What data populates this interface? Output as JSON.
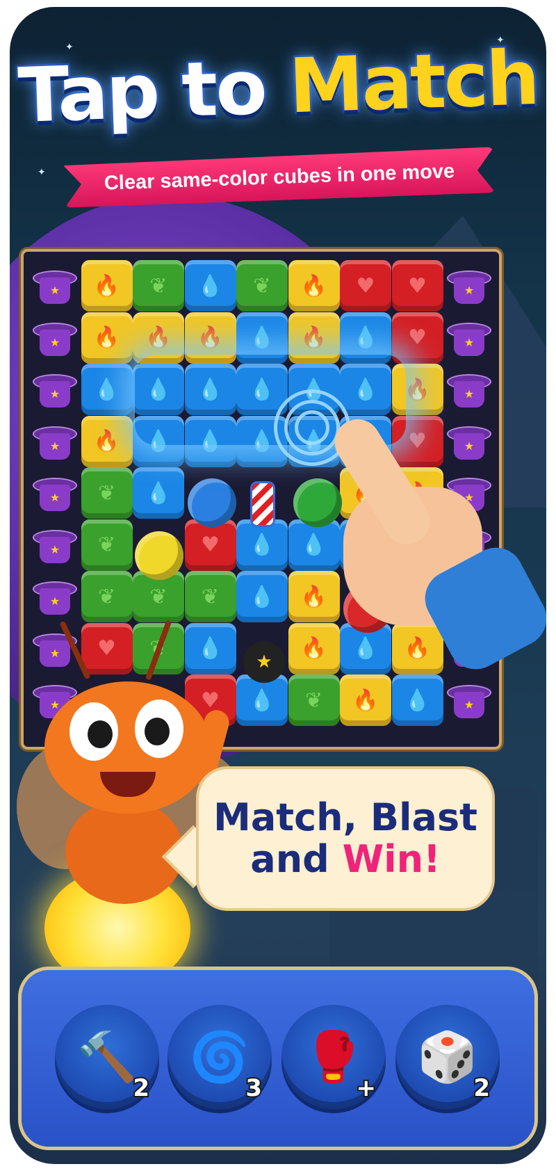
{
  "title": {
    "word1": "Tap to",
    "word2": "Match"
  },
  "subtitle": "Clear same-color cubes in one move",
  "speech": {
    "line1": "Match, Blast",
    "line2_prefix": "and ",
    "line2_highlight": "Win!"
  },
  "board": {
    "columns": 9,
    "grid": [
      [
        "hat",
        "yellow",
        "green",
        "blue",
        "green",
        "yellow",
        "red",
        "red",
        "hat"
      ],
      [
        "hat",
        "yellow",
        "yellow",
        "yellow",
        "blue",
        "yellow",
        "blue",
        "red",
        "hat"
      ],
      [
        "hat",
        "blue",
        "blue",
        "blue",
        "blue",
        "blue",
        "blue",
        "yellow",
        "hat"
      ],
      [
        "hat",
        "yellow",
        "blue",
        "blue",
        "blue",
        "blue",
        "blue",
        "red",
        "hat"
      ],
      [
        "hat",
        "green",
        "blue",
        "",
        "",
        "",
        "yellow",
        "yellow",
        "hat"
      ],
      [
        "hat",
        "green",
        "",
        "red",
        "blue",
        "blue",
        "blue",
        "yellow",
        "hat"
      ],
      [
        "hat",
        "green",
        "green",
        "green",
        "blue",
        "yellow",
        "",
        "yellow",
        "hat"
      ],
      [
        "hat",
        "red",
        "green",
        "blue",
        "",
        "yellow",
        "blue",
        "yellow",
        "hat"
      ],
      [
        "hat",
        "",
        "",
        "red",
        "blue",
        "green",
        "yellow",
        "blue",
        "hat"
      ]
    ],
    "symbols": {
      "yellow": "🔥",
      "green": "❦",
      "blue": "💧",
      "red": "♥",
      "hat": "★"
    }
  },
  "boosters": [
    {
      "name": "hammer",
      "icon": "🔨",
      "count": "2"
    },
    {
      "name": "drill",
      "icon": "🌀",
      "count": "3"
    },
    {
      "name": "boxing-glove",
      "icon": "🥊",
      "count": "+"
    },
    {
      "name": "dice",
      "icon": "🎲",
      "count": "2"
    }
  ],
  "colors": {
    "yellow": "#f2c623",
    "green": "#3aa12c",
    "blue": "#1b86e6",
    "red": "#d41f24",
    "title_white": "#ffffff",
    "title_yellow": "#ffd21e",
    "ribbon": "#e81e64",
    "speech_text": "#1b2d7a",
    "win": "#f0237a"
  }
}
